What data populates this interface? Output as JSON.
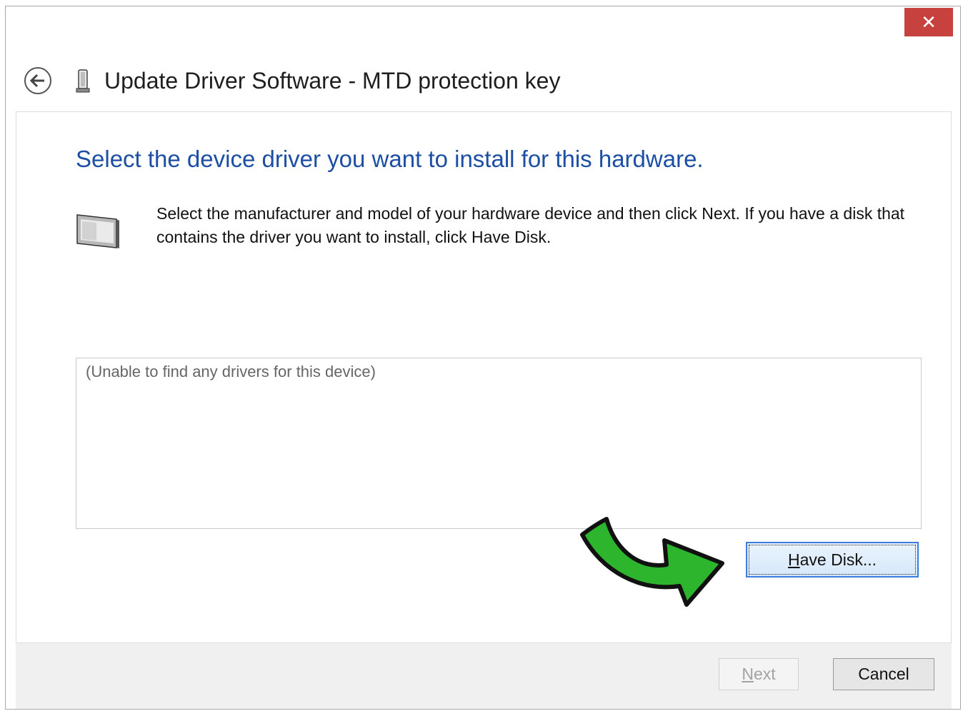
{
  "window": {
    "close_glyph": "✕",
    "title": "Update Driver Software - MTD protection key",
    "icons": {
      "back": "back-arrow-icon",
      "title": "usb-key-icon",
      "device": "hardware-device-icon",
      "arrow": "green-curved-arrow"
    }
  },
  "main": {
    "heading": "Select the device driver you want to install for this hardware.",
    "instruction": "Select the manufacturer and model of your hardware device and then click Next. If you have a disk that contains the driver you want to install, click Have Disk.",
    "list_message": "(Unable to find any drivers for this device)",
    "have_disk": {
      "accel": "H",
      "rest": "ave Disk..."
    }
  },
  "footer": {
    "next": {
      "accel": "N",
      "rest": "ext"
    },
    "cancel": "Cancel"
  },
  "colors": {
    "heading": "#1c4ea3",
    "close": "#c7423e",
    "arrow": "#2db52d"
  }
}
